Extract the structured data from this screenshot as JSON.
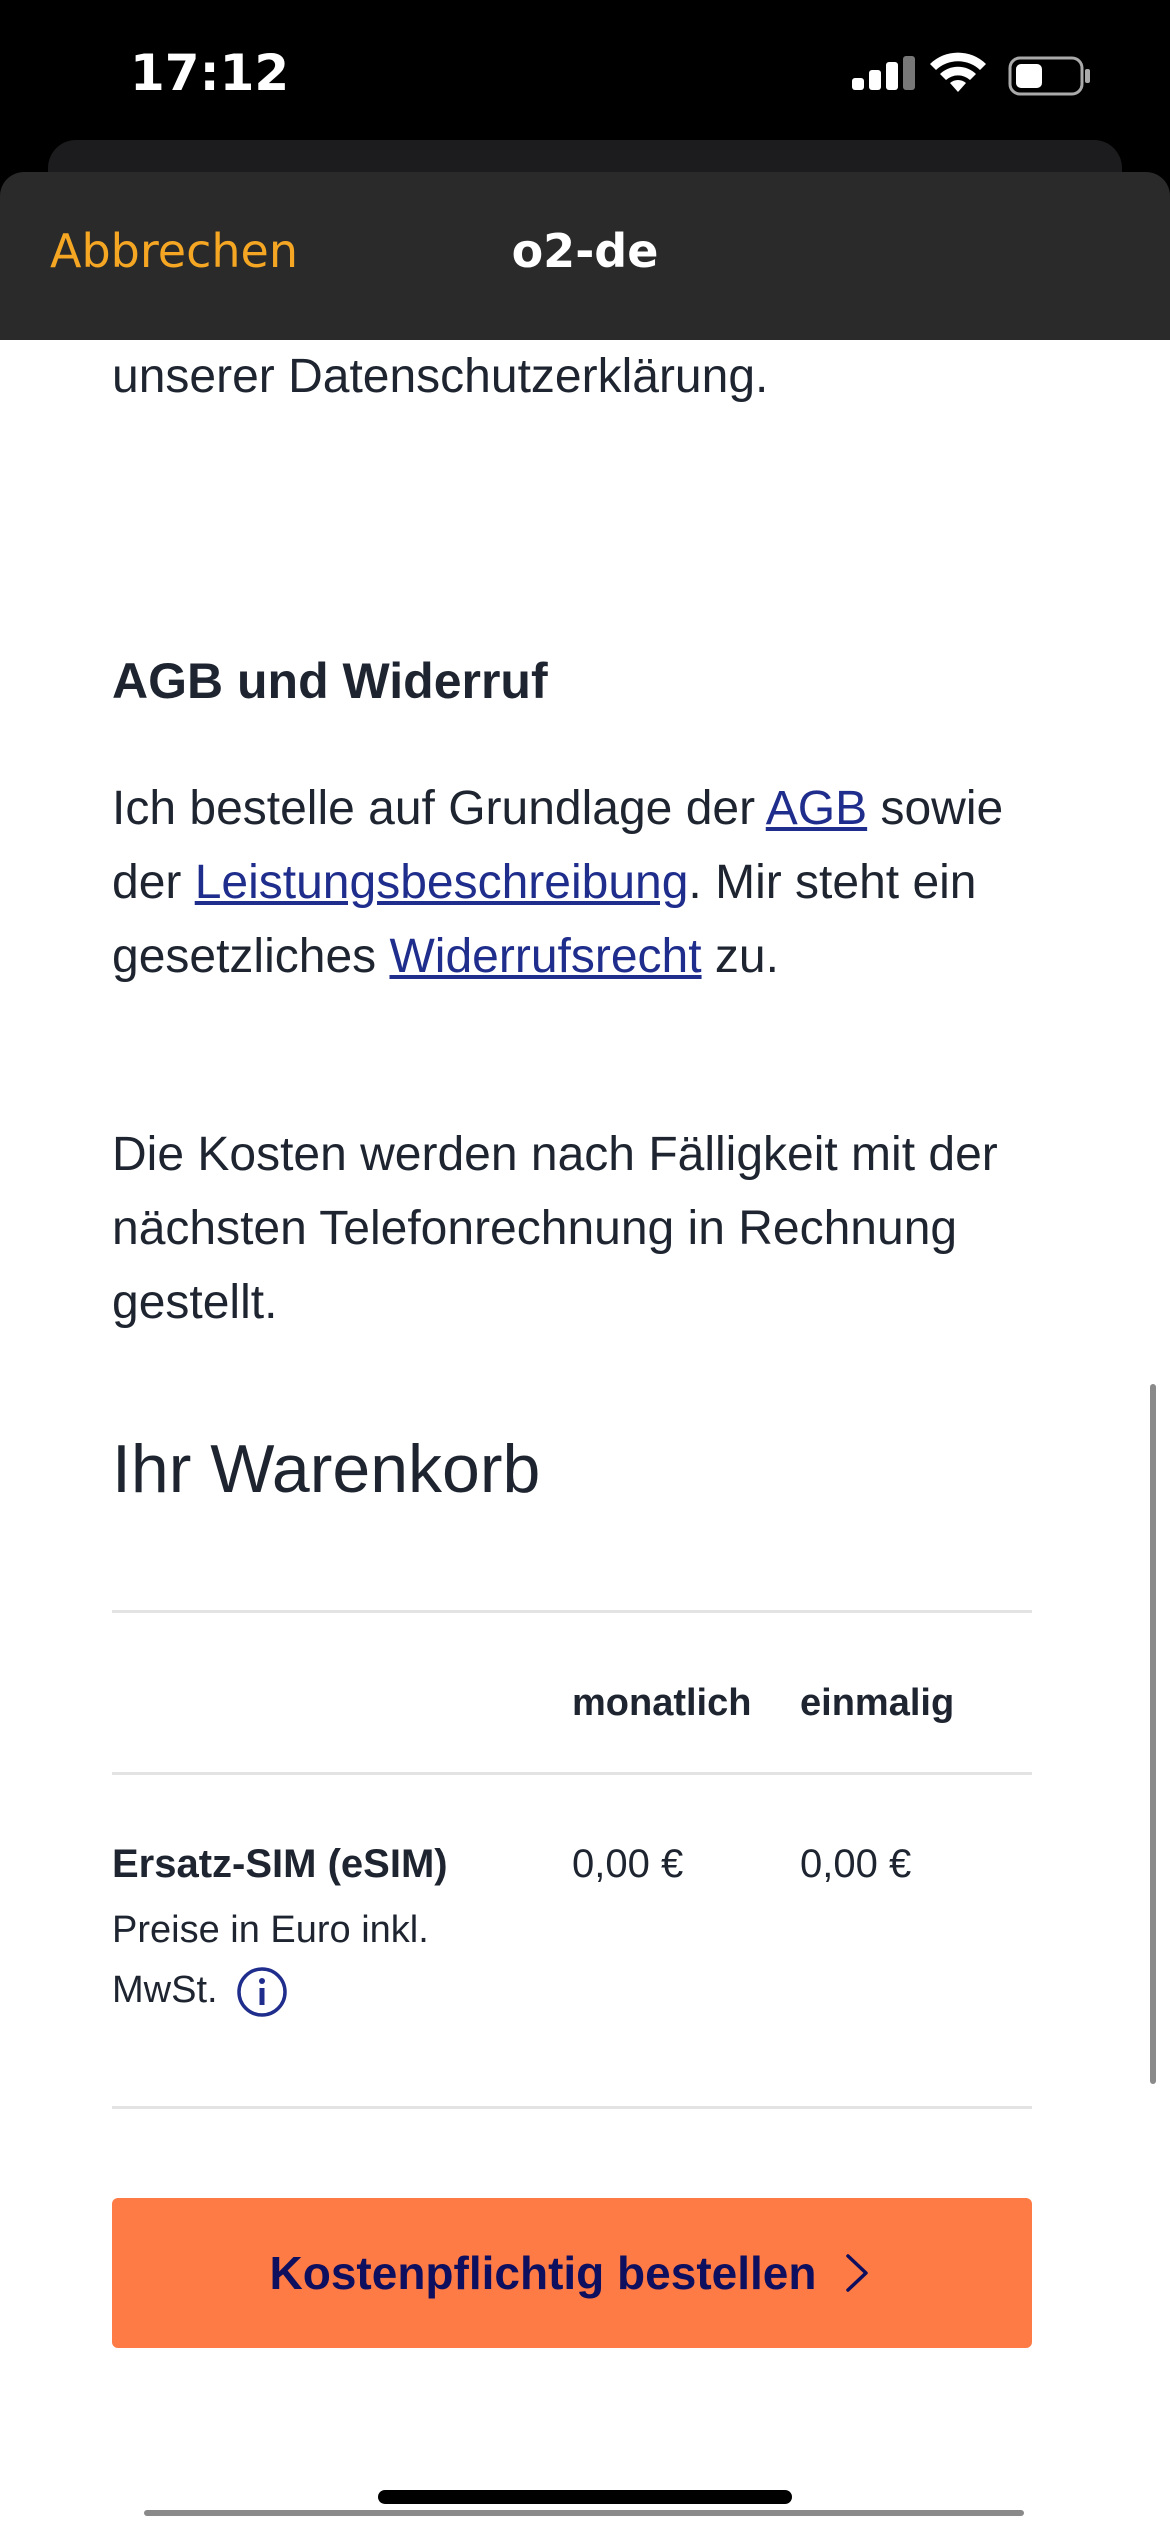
{
  "status_bar": {
    "time": "17:12"
  },
  "navbar": {
    "cancel_label": "Abbrechen",
    "title": "o2-de"
  },
  "content": {
    "top_text": "unserer Datenschutzerklärung.",
    "agb_heading": "AGB und Widerruf",
    "agb_text": {
      "part1": "Ich bestelle auf Grundlage der ",
      "link_agb": "AGB",
      "part2": " sowie der ",
      "link_leistung": "Leistungsbeschreibung",
      "part3": ". Mir steht ein gesetzliches ",
      "link_widerruf": "Widerrufsrecht",
      "part4": " zu."
    },
    "cost_text": "Die Kosten werden nach Fälligkeit mit der nächsten Telefonrechnung in Rechnung gestellt."
  },
  "cart": {
    "heading": "Ihr Warenkorb",
    "columns": [
      "monatlich",
      "einmalig"
    ],
    "items": [
      {
        "name": "Ersatz-SIM (eSIM)",
        "note": "Preise in Euro inkl. MwSt.",
        "monthly": "0,00 €",
        "once": "0,00 €"
      }
    ]
  },
  "order_button": {
    "label": "Kostenpflichtig bestellen"
  },
  "colors": {
    "accent_orange": "#ff7b45",
    "cancel_orange": "#f5a623",
    "link_blue": "#1f2d8c",
    "button_text": "#0e0f5e"
  },
  "icons": [
    "signal-icon",
    "wifi-icon",
    "battery-icon",
    "info-icon",
    "chevron-right-icon"
  ]
}
